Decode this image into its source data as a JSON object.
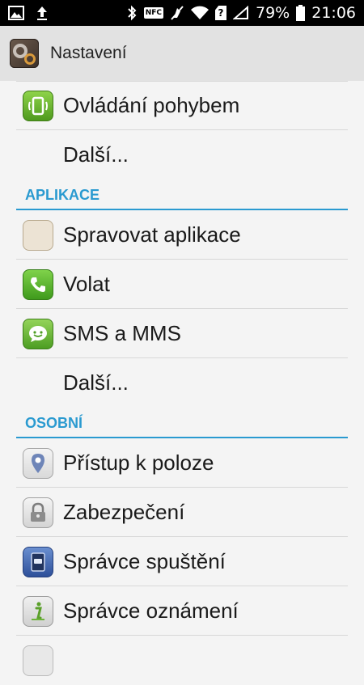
{
  "status_bar": {
    "battery": "79%",
    "time": "21:06",
    "nfc": "NFC",
    "sim": "?"
  },
  "action_bar": {
    "title": "Nastavení",
    "icon": "settings-gears-icon"
  },
  "list": {
    "items_top": [
      {
        "label": "Ovládání pohybem",
        "icon": "motion-control-icon"
      },
      {
        "label": "Další...",
        "icon": ""
      }
    ],
    "section_apps": "APLIKACE",
    "items_apps": [
      {
        "label": "Spravovat aplikace",
        "icon": "apps-grid-icon"
      },
      {
        "label": "Volat",
        "icon": "phone-icon"
      },
      {
        "label": "SMS a MMS",
        "icon": "sms-icon"
      },
      {
        "label": "Další...",
        "icon": ""
      }
    ],
    "section_personal": "OSOBNÍ",
    "items_personal": [
      {
        "label": "Přístup k poloze",
        "icon": "location-pin-icon"
      },
      {
        "label": "Zabezpečení",
        "icon": "lock-icon"
      },
      {
        "label": "Správce spuštění",
        "icon": "startup-manager-icon"
      },
      {
        "label": "Správce oznámení",
        "icon": "info-icon"
      }
    ]
  },
  "colors": {
    "accent": "#2a9ad0",
    "statusbar": "#000000",
    "actionbar": "#e2e2e2",
    "background": "#f4f4f4"
  }
}
